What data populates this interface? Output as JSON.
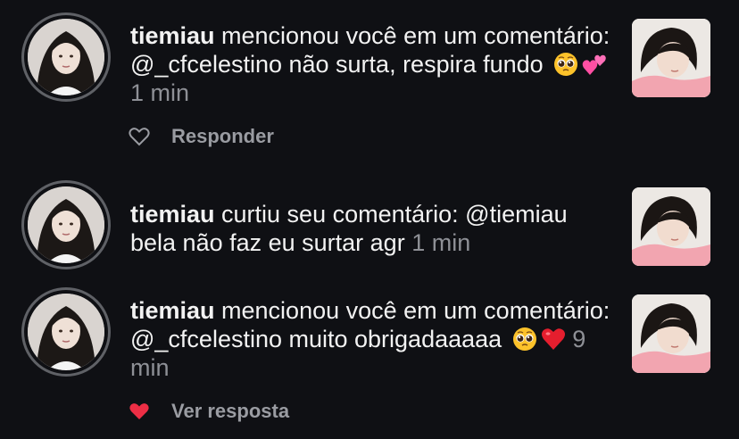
{
  "notifications": [
    {
      "username": "tiemiau",
      "message": " mencionou você em um comentário: @_cfcelestino não surta, respira fundo",
      "emojis": [
        "pleading-face",
        "two-hearts"
      ],
      "time": "1 min",
      "action": {
        "icon": "heart-outline",
        "label": "Responder"
      }
    },
    {
      "username": "tiemiau",
      "message": " curtiu seu comentário: @tiemiau bela não faz eu surtar agr",
      "emojis": [],
      "time": "1 min"
    },
    {
      "username": "tiemiau",
      "message": " mencionou você em um comentário: @_cfcelestino muito obrigadaaaaa",
      "emojis": [
        "pleading-face",
        "red-heart"
      ],
      "time": "9 min",
      "action": {
        "icon": "heart-filled",
        "label": "Ver resposta"
      }
    }
  ],
  "colors": {
    "background": "#0f1014",
    "text": "#f2f2f2",
    "muted": "#8e9096",
    "like_red": "#ed2e45"
  }
}
